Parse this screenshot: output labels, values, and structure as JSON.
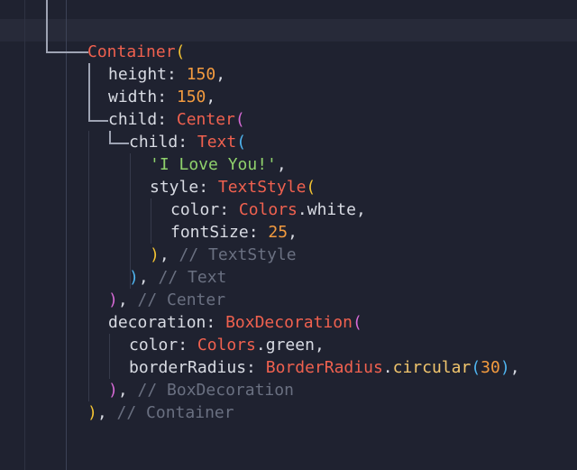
{
  "code": {
    "container": "Container",
    "height_prop": "height",
    "height_val": "150",
    "width_prop": "width",
    "width_val": "150",
    "child_prop": "child",
    "center": "Center",
    "text_widget": "Text",
    "text_string": "'I Love You!'",
    "style_prop": "style",
    "textstyle": "TextStyle",
    "color_prop": "color",
    "colors": "Colors",
    "white": "white",
    "fontsize_prop": "fontSize",
    "fontsize_val": "25",
    "comment_textstyle": "// TextStyle",
    "comment_text": "// Text",
    "comment_center": "// Center",
    "decoration_prop": "decoration",
    "boxdecoration": "BoxDecoration",
    "green": "green",
    "borderradius_prop": "borderRadius",
    "borderradius_class": "BorderRadius",
    "circular": "circular",
    "radius_val": "30",
    "comment_boxdecoration": "// BoxDecoration",
    "comment_container": "// Container"
  }
}
